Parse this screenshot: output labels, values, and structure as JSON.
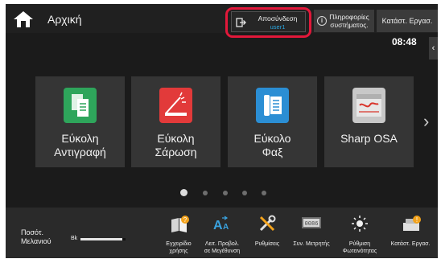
{
  "header": {
    "home_title": "Αρχική",
    "logout_label": "Αποσύνδεση",
    "logout_user": "user1",
    "info_label": "Πληροφορίες συστήματος.",
    "job_status_label": "Κατάστ. Εργασ.",
    "clock": "08:48"
  },
  "tiles": [
    {
      "label_line1": "Εύκολη",
      "label_line2": "Αντιγραφή",
      "icon": "copy-icon",
      "color": "#2ea55b"
    },
    {
      "label_line1": "Εύκολη",
      "label_line2": "Σάρωση",
      "icon": "scan-icon",
      "color": "#e23a3a"
    },
    {
      "label_line1": "Εύκολο",
      "label_line2": "Φαξ",
      "icon": "fax-icon",
      "color": "#2b8ed4"
    },
    {
      "label_line1": "Sharp OSA",
      "label_line2": "",
      "icon": "sharp-osa-icon",
      "color": "#c8c8c8"
    }
  ],
  "pager": {
    "pages": 5,
    "current": 1
  },
  "footer": {
    "toner_label_line1": "Ποσότ.",
    "toner_label_line2": "Μελανιού",
    "toner_color": "Bk",
    "toner_level": 0.92,
    "items": [
      {
        "label_line1": "Εγχειρίδιο",
        "label_line2": "χρήσης",
        "icon": "manual-icon"
      },
      {
        "label_line1": "Λειτ. Προβολ.",
        "label_line2": "σε Μεγέθυνση",
        "icon": "enlarge-display-icon"
      },
      {
        "label_line1": "Ρυθμίσεις",
        "label_line2": "",
        "icon": "settings-icon"
      },
      {
        "label_line1": "Συν. Μετρητής",
        "label_line2": "",
        "icon": "counter-icon"
      },
      {
        "label_line1": "Ρύθμιση",
        "label_line2": "Φωτεινότητας",
        "icon": "brightness-icon"
      },
      {
        "label_line1": "Κατάστ. Εργασ.",
        "label_line2": "",
        "icon": "job-status-icon"
      }
    ]
  }
}
